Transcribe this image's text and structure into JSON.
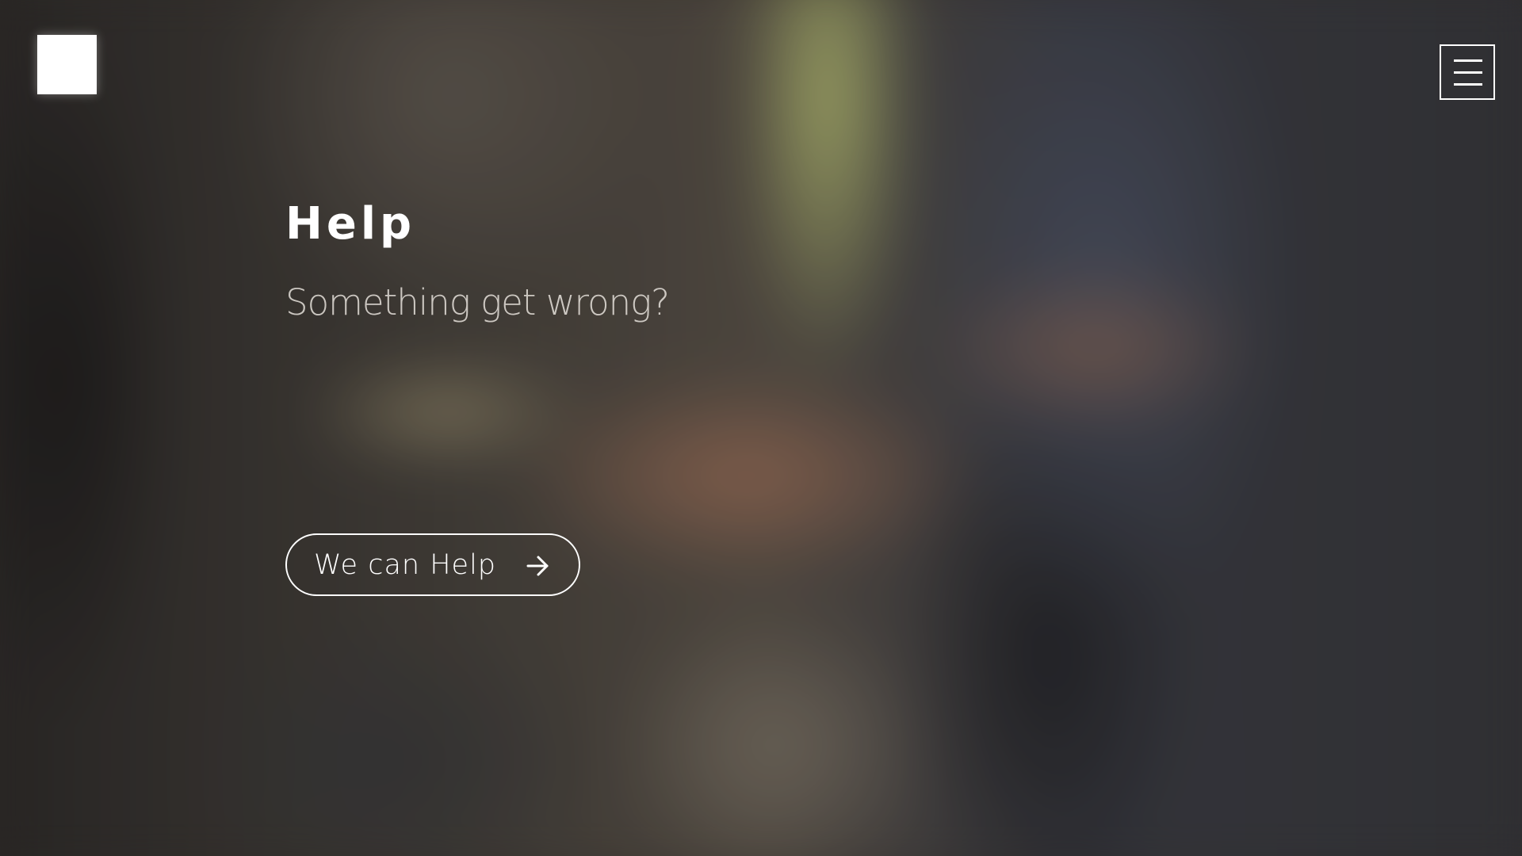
{
  "header": {
    "logo": "white-square-logo",
    "menu_icon": "hamburger-menu-icon"
  },
  "hero": {
    "title": "Help",
    "subtitle": "Something get wrong?",
    "cta_label": "We can Help",
    "cta_icon": "arrow-right-icon"
  },
  "colors": {
    "text": "#ffffff",
    "subtitle": "#ebe6e1",
    "background": "#3a3530"
  }
}
